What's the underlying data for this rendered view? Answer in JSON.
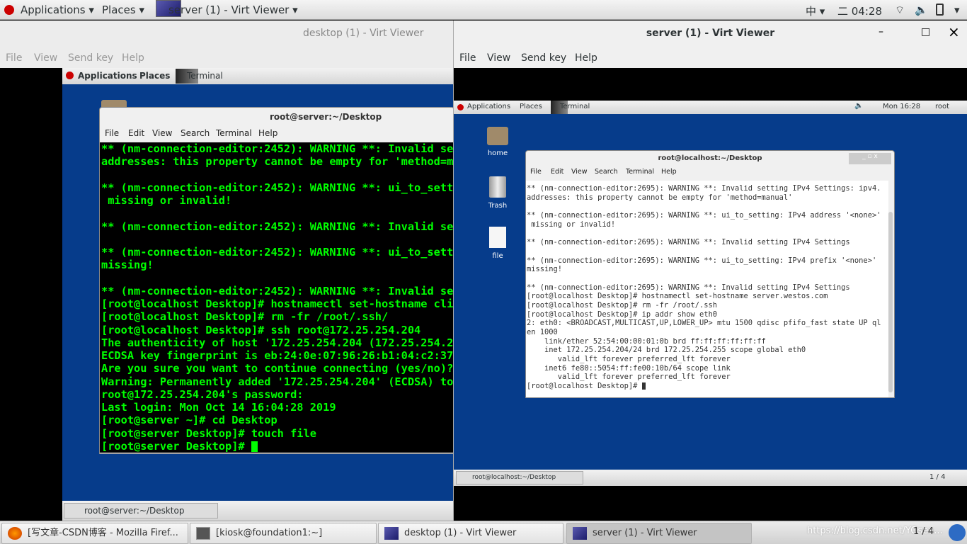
{
  "topbar": {
    "applications": "Applications ▾",
    "places": "Places ▾",
    "window": "server (1) - Virt Viewer ▾",
    "input_method": "中 ▾",
    "clock": "二 04:28",
    "icons": [
      "wifi-icon",
      "volume-icon",
      "battery-icon"
    ]
  },
  "left_window": {
    "title": "desktop (1) - Virt Viewer",
    "menu": [
      "File",
      "View",
      "Send key",
      "Help"
    ],
    "guest": {
      "applications": "Applications",
      "places": "Places",
      "terminal": "Terminal",
      "task": "root@server:~/Desktop",
      "terminal_window": {
        "title": "root@server:~/Desktop",
        "menu": [
          "File",
          "Edit",
          "View",
          "Search",
          "Terminal",
          "Help"
        ],
        "lines": [
          "** (nm-connection-editor:2452): WARNING **: Invalid set",
          "addresses: this property cannot be empty for 'method=ma",
          "",
          "** (nm-connection-editor:2452): WARNING **: ui_to_setti",
          " missing or invalid!",
          "",
          "** (nm-connection-editor:2452): WARNING **: Invalid set",
          "",
          "** (nm-connection-editor:2452): WARNING **: ui_to_setti",
          "missing!",
          "",
          "** (nm-connection-editor:2452): WARNING **: Invalid set",
          "[root@localhost Desktop]# hostnamectl set-hostname clie",
          "[root@localhost Desktop]# rm -fr /root/.ssh/",
          "[root@localhost Desktop]# ssh root@172.25.254.204",
          "The authenticity of host '172.25.254.204 (172.25.254.20",
          "ECDSA key fingerprint is eb:24:0e:07:96:26:b1:04:c2:37:",
          "Are you sure you want to continue connecting (yes/no)?",
          "Warning: Permanently added '172.25.254.204' (ECDSA) to",
          "root@172.25.254.204's password:",
          "Last login: Mon Oct 14 16:04:28 2019",
          "[root@server ~]# cd Desktop",
          "[root@server Desktop]# touch file",
          "[root@server Desktop]# "
        ]
      }
    }
  },
  "right_window": {
    "title": "server (1) - Virt Viewer",
    "menu": [
      "File",
      "View",
      "Send key",
      "Help"
    ],
    "controls": {
      "minimize": "–",
      "maximize": "□",
      "close": "×"
    },
    "guest": {
      "applications": "Applications",
      "places": "Places",
      "terminal": "Terminal",
      "clock": "Mon 16:28",
      "user": "root",
      "task": "root@localhost:~/Desktop",
      "workspace": "1 / 4",
      "desktop_icons": [
        "home",
        "Trash",
        "file"
      ],
      "terminal_window": {
        "title": "root@localhost:~/Desktop",
        "menu": [
          "File",
          "Edit",
          "View",
          "Search",
          "Terminal",
          "Help"
        ],
        "lines": [
          "** (nm-connection-editor:2695): WARNING **: Invalid setting IPv4 Settings: ipv4.",
          "addresses: this property cannot be empty for 'method=manual'",
          "",
          "** (nm-connection-editor:2695): WARNING **: ui_to_setting: IPv4 address '<none>'",
          " missing or invalid!",
          "",
          "** (nm-connection-editor:2695): WARNING **: Invalid setting IPv4 Settings",
          "",
          "** (nm-connection-editor:2695): WARNING **: ui_to_setting: IPv4 prefix '<none>'",
          "missing!",
          "",
          "** (nm-connection-editor:2695): WARNING **: Invalid setting IPv4 Settings",
          "[root@localhost Desktop]# hostnamectl set-hostname server.westos.com",
          "[root@localhost Desktop]# rm -fr /root/.ssh",
          "[root@localhost Desktop]# ip addr show eth0",
          "2: eth0: <BROADCAST,MULTICAST,UP,LOWER_UP> mtu 1500 qdisc pfifo_fast state UP ql",
          "en 1000",
          "    link/ether 52:54:00:00:01:0b brd ff:ff:ff:ff:ff:ff",
          "    inet 172.25.254.204/24 brd 172.25.254.255 scope global eth0",
          "       valid_lft forever preferred_lft forever",
          "    inet6 fe80::5054:ff:fe00:10b/64 scope link",
          "       valid_lft forever preferred_lft forever",
          "[root@localhost Desktop]# "
        ]
      }
    }
  },
  "taskbar": {
    "items": [
      "[写文章-CSDN博客 - Mozilla Firef...",
      "[kiosk@foundation1:~]",
      "desktop (1) - Virt Viewer",
      "server (1) - Virt Viewer"
    ],
    "workspace": "1 / 4",
    "watermark": "https://blog.csdn.net/YOsea..."
  },
  "colors": {
    "guest_desktop": "#063c8b",
    "term_green": "#00ff00",
    "accent_red": "#cc0000"
  }
}
